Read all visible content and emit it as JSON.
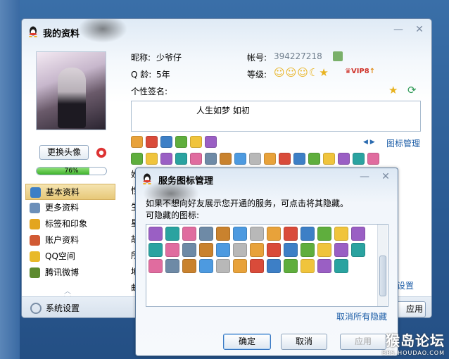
{
  "main_window": {
    "title": "我的资料",
    "profile": {
      "nickname_label": "昵称:",
      "nickname": "少爷仔",
      "account_label": "帐号:",
      "account": "394227218",
      "age_label": "Q 龄:",
      "age": "5年",
      "level_label": "等级:",
      "vip": "VIP8",
      "signature_label": "个性签名:",
      "signature": "人生如梦 如初"
    },
    "change_avatar_label": "更换头像",
    "completion_percent": 76,
    "completion_text": "76%",
    "icon_manage_link": "图标管理",
    "nav": [
      {
        "label": "基本资料",
        "icon": "id-card-icon",
        "color": "#3d7fc6",
        "active": true
      },
      {
        "label": "更多资料",
        "icon": "document-icon",
        "color": "#6b8fb9",
        "active": false
      },
      {
        "label": "标签和印象",
        "icon": "tag-icon",
        "color": "#e3a51f",
        "active": false
      },
      {
        "label": "账户资料",
        "icon": "account-icon",
        "color": "#d15a34",
        "active": false
      },
      {
        "label": "QQ空间",
        "icon": "star-icon",
        "color": "#e8b92a",
        "active": false
      },
      {
        "label": "腾讯微博",
        "icon": "weibo-icon",
        "color": "#5d8a2f",
        "active": false
      }
    ],
    "system_settings": "系统设置",
    "partial_left_chars": [
      "姓",
      "性",
      "生",
      "星",
      "故",
      "所",
      "地",
      "邮"
    ],
    "partial_right_text": "设置",
    "partial_right_button": "应用"
  },
  "dialog": {
    "title": "服务图标管理",
    "instruction": "如果不想向好友展示您开通的服务，可点击将其隐藏。",
    "hideable_label": "可隐藏的图标:",
    "unhide_all_link": "取消所有隐藏",
    "ok_button": "确定",
    "cancel_button": "取消",
    "apply_button": "应用"
  },
  "watermark": {
    "text": "猴岛论坛",
    "sub": "BBS.HOUDAO.COM"
  },
  "icon_colors": [
    "#e8a23a",
    "#d94b3a",
    "#3d7fc6",
    "#5fae3d",
    "#f0c43c",
    "#9a5fc4",
    "#2aa3a0",
    "#e06c9f",
    "#6e8aa6",
    "#c9822e",
    "#4d9ae0",
    "#b8b8b8"
  ]
}
